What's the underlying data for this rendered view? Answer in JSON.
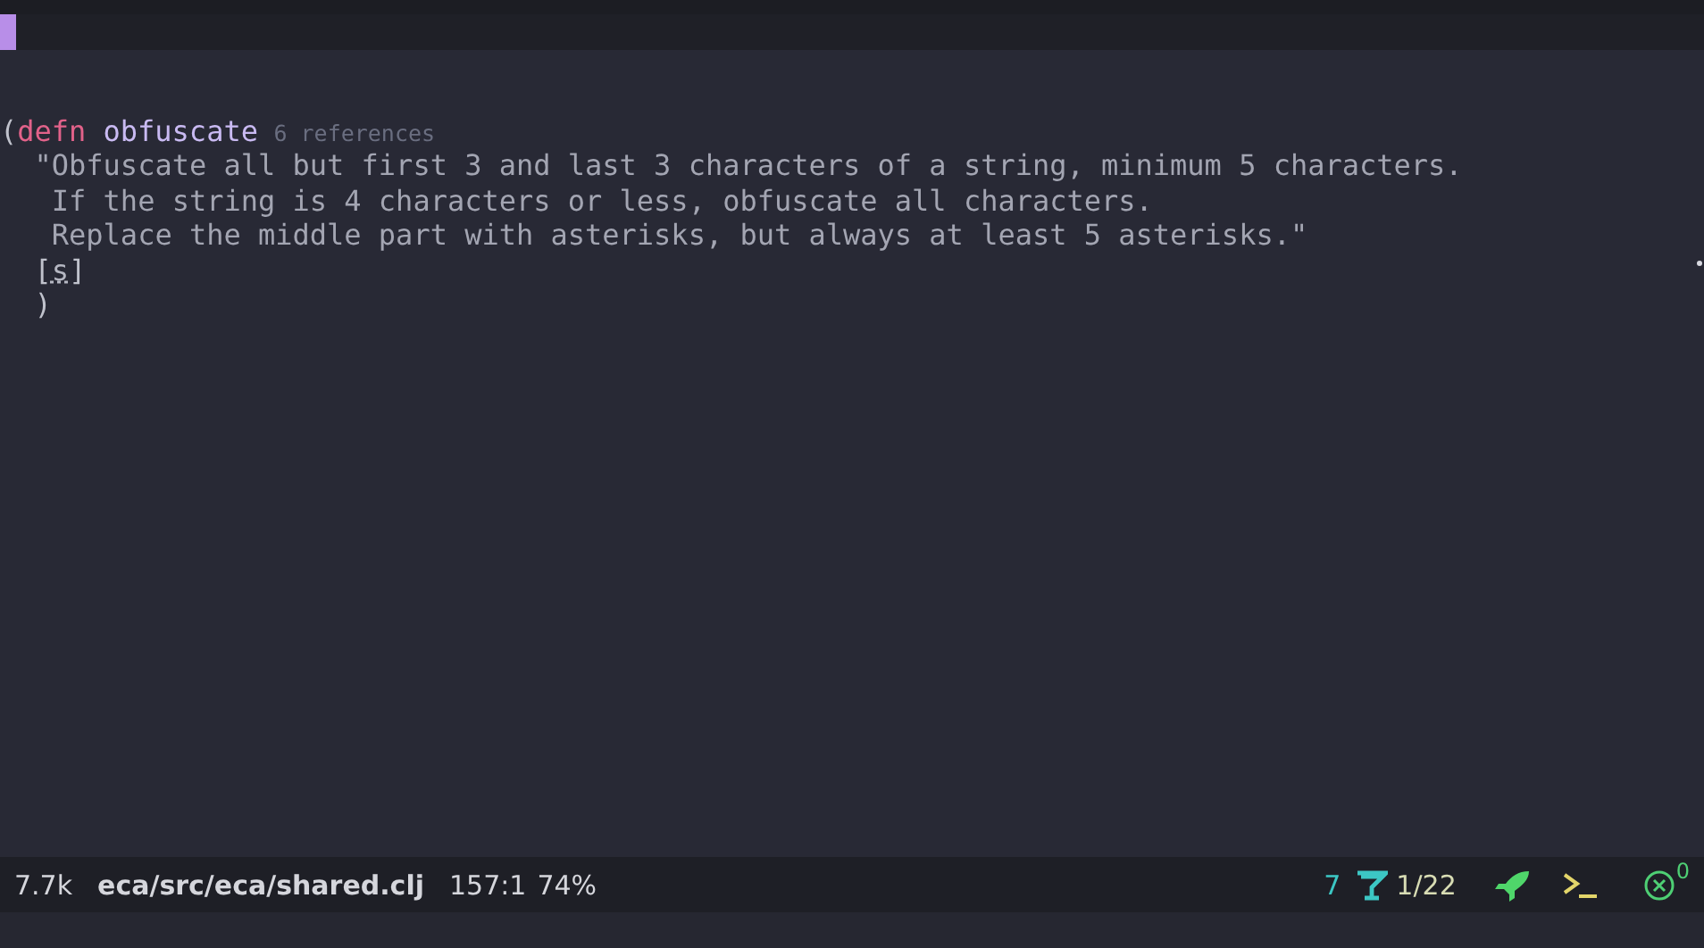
{
  "editor": {
    "lines": [
      [
        {
          "text": "(",
          "kind": "paren"
        },
        {
          "text": "defn",
          "kind": "keyword"
        },
        {
          "text": "obfuscate",
          "kind": "function"
        },
        {
          "text": "6 references",
          "kind": "hint"
        }
      ],
      [
        {
          "text": "  \"Obfuscate all but first 3 and last 3 characters of a string, minimum 5 characters.",
          "kind": "string"
        }
      ],
      [
        {
          "text": "   If the string is 4 characters or less, obfuscate all characters.",
          "kind": "string"
        }
      ],
      [
        {
          "text": "   Replace the middle part with asterisks, but always at least 5 asterisks.\"",
          "kind": "string"
        }
      ],
      [
        {
          "text": "  [",
          "kind": "paren"
        },
        {
          "text": "s",
          "kind": "param"
        },
        {
          "text": "]",
          "kind": "paren"
        }
      ],
      [
        {
          "text": "  )",
          "kind": "paren"
        }
      ]
    ]
  },
  "mode_line": {
    "size": "7.7k",
    "file": "eca/src/eca/shared.clj",
    "position": "157:1",
    "percent": "74%",
    "match_count": "7",
    "search_index": "1/22",
    "error_count": "0"
  }
}
